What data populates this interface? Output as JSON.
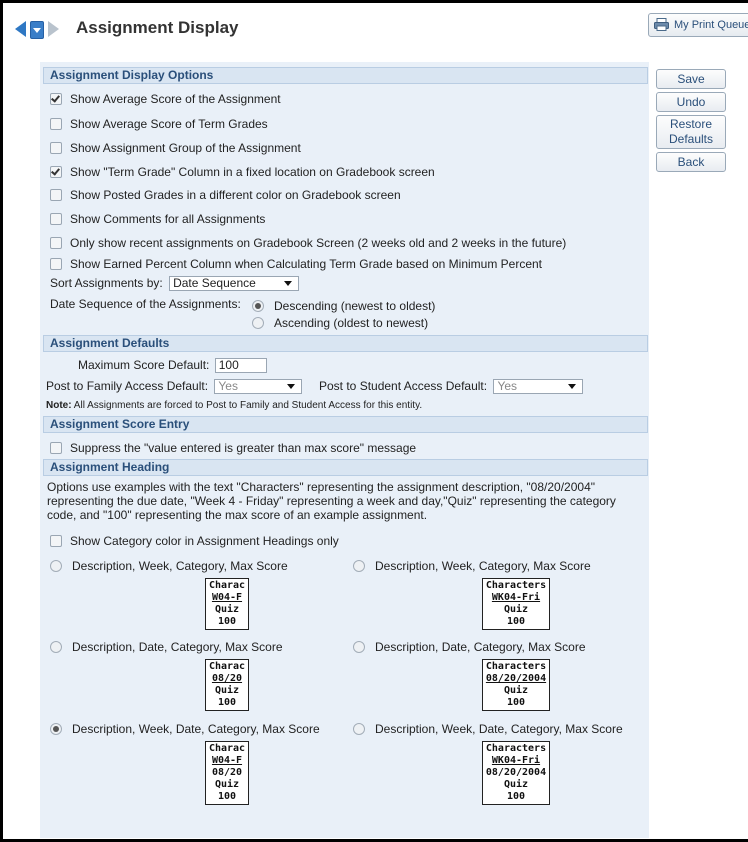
{
  "header": {
    "title": "Assignment Display",
    "print_queue_label": "My Print Queue"
  },
  "sections": {
    "display_options": "Assignment Display Options",
    "defaults": "Assignment Defaults",
    "score_entry": "Assignment Score Entry",
    "heading": "Assignment Heading"
  },
  "options": [
    {
      "label": "Show Average Score of the Assignment",
      "checked": true
    },
    {
      "label": "Show Average Score of Term Grades",
      "checked": false
    },
    {
      "label": "Show Assignment Group of the Assignment",
      "checked": false
    },
    {
      "label": "Show \"Term Grade\" Column in a fixed location on Gradebook screen",
      "checked": true
    },
    {
      "label": "Show Posted Grades in a different color on Gradebook screen",
      "checked": false
    },
    {
      "label": "Show Comments for all Assignments",
      "checked": false
    },
    {
      "label": "Only show recent assignments on Gradebook Screen (2 weeks old and 2 weeks in the future)",
      "checked": false
    },
    {
      "label": "Show Earned Percent Column when Calculating Term Grade based on Minimum Percent",
      "checked": false
    }
  ],
  "sort": {
    "label": "Sort Assignments by:",
    "value": "Date Sequence"
  },
  "date_sequence": {
    "label": "Date Sequence of the Assignments:",
    "descending": "Descending (newest to oldest)",
    "ascending": "Ascending (oldest to newest)",
    "selected": "descending"
  },
  "defaults": {
    "max_score_label": "Maximum Score Default:",
    "max_score_value": "100",
    "family_label": "Post to Family Access Default:",
    "family_value": "Yes",
    "student_label": "Post to Student Access Default:",
    "student_value": "Yes",
    "note_bold": "Note:",
    "note_text": "All Assignments are forced to Post to Family and Student Access for this entity."
  },
  "score_entry": {
    "suppress_label": "Suppress the \"value entered is greater than max score\" message",
    "checked": false
  },
  "heading": {
    "description": "Options use examples with the text \"Characters\" representing the assignment description, \"08/20/2004\" representing the due date, \"Week 4 - Friday\" representing a week and day,\"Quiz\" representing the category code, and \"100\" representing the max score of an example assignment.",
    "category_color_label": "Show Category color in Assignment Headings only",
    "category_color_checked": false,
    "formats": [
      {
        "label": "Description, Week, Category, Max Score",
        "selected": false,
        "lines": [
          "Charac",
          "W04-F",
          "Quiz",
          "100"
        ]
      },
      {
        "label": "Description, Week, Category, Max Score",
        "selected": false,
        "lines": [
          "Characters",
          "WK04-Fri",
          "Quiz",
          "100"
        ]
      },
      {
        "label": "Description, Date, Category, Max Score",
        "selected": false,
        "lines": [
          "Charac",
          "08/20",
          "Quiz",
          "100"
        ]
      },
      {
        "label": "Description, Date, Category, Max Score",
        "selected": false,
        "lines": [
          "Characters",
          "08/20/2004",
          "Quiz",
          "100"
        ]
      },
      {
        "label": "Description, Week, Date, Category, Max Score",
        "selected": true,
        "lines": [
          "Charac",
          "W04-F",
          "08/20",
          "Quiz",
          "100"
        ]
      },
      {
        "label": "Description, Week, Date, Category, Max Score",
        "selected": false,
        "lines": [
          "Characters",
          "WK04-Fri",
          "08/20/2004",
          "Quiz",
          "100"
        ]
      }
    ]
  },
  "actions": {
    "save": "Save",
    "undo": "Undo",
    "restore": "Restore Defaults",
    "back": "Back"
  }
}
